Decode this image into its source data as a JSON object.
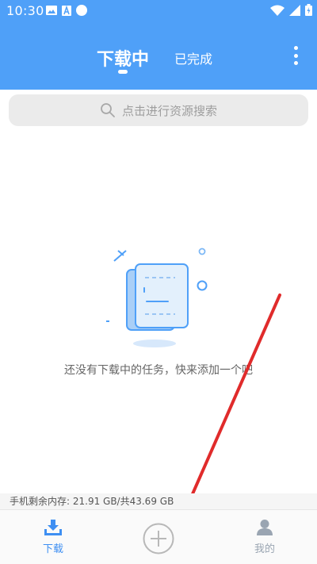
{
  "status": {
    "time": "10:30"
  },
  "header": {
    "tab_active": "下载中",
    "tab_other": "已完成",
    "colors": {
      "header_bg": "#4fa0f8"
    }
  },
  "search": {
    "placeholder": "点击进行资源搜索"
  },
  "empty_state": {
    "text": "还没有下载中的任务，快来添加一个吧"
  },
  "memory": {
    "text": "手机剩余内存: 21.91 GB/共43.69 GB"
  },
  "bottom_nav": {
    "download_label": "下载",
    "mine_label": "我的"
  },
  "icons": {
    "status": [
      "image-icon",
      "a-icon",
      "circle-icon",
      "wifi-icon",
      "signal-icon",
      "battery-icon"
    ],
    "search": "search-icon",
    "more": "more-vertical-icon",
    "add": "plus-circle-icon",
    "download": "download-tray-icon",
    "mine": "user-icon"
  }
}
